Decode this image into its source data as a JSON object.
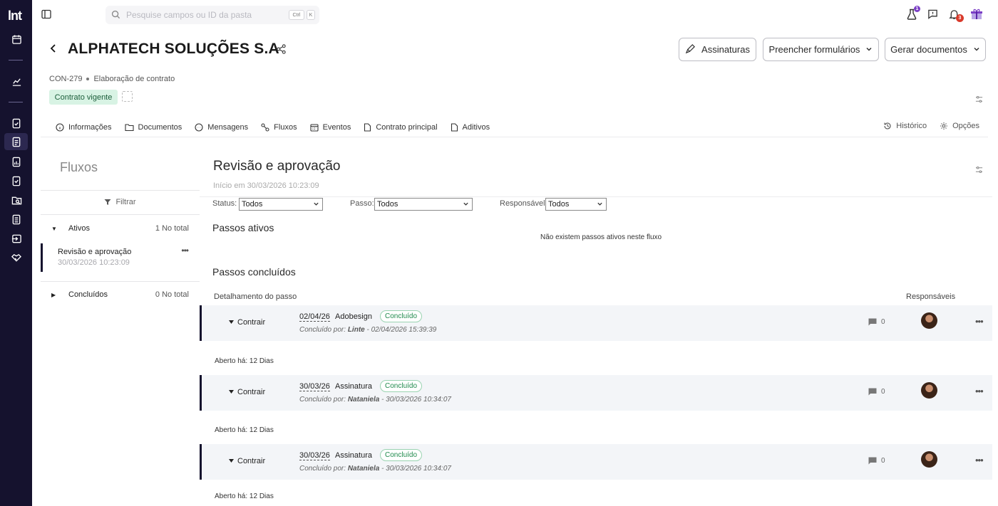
{
  "app": {
    "logo": "lnt"
  },
  "search": {
    "placeholder": "Pesquise campos ou ID da pasta",
    "shortcut_ctrl": "Ctrl",
    "shortcut_key": "K"
  },
  "topbar": {
    "flask_badge": "1",
    "notifications_badge": "3"
  },
  "header": {
    "title": "ALPHATECH SOLUÇÕES S.A",
    "code": "CON-279",
    "stage": "Elaboração de contrato",
    "status": "Contrato vigente",
    "buttons": {
      "signatures": "Assinaturas",
      "fill_forms": "Preencher formulários",
      "generate_docs": "Gerar documentos"
    }
  },
  "tabs": [
    {
      "label": "Informações",
      "icon": "info-icon"
    },
    {
      "label": "Documentos",
      "icon": "folder-icon"
    },
    {
      "label": "Mensagens",
      "icon": "chat-icon"
    },
    {
      "label": "Fluxos",
      "icon": "flow-icon"
    },
    {
      "label": "Eventos",
      "icon": "calendar-icon"
    },
    {
      "label": "Contrato principal",
      "icon": "file-icon"
    },
    {
      "label": "Aditivos",
      "icon": "file-icon"
    }
  ],
  "tabs_right": {
    "history": "Histórico",
    "options": "Opções"
  },
  "left_panel": {
    "title": "Fluxos",
    "filter": "Filtrar",
    "active_group": {
      "label": "Ativos",
      "count": "1 No total"
    },
    "active_item": {
      "name": "Revisão e aprovação",
      "date": "30/03/2026 10:23:09"
    },
    "done_group": {
      "label": "Concluídos",
      "count": "0 No total"
    }
  },
  "flow": {
    "title": "Revisão e aprovação",
    "started": "Início em 30/03/2026 10:23:09",
    "filters": {
      "status_label": "Status:",
      "status_value": "Todos",
      "step_label": "Passo:",
      "step_value": "Todos",
      "responsible_label": "Responsável:",
      "responsible_value": "Todos"
    },
    "active_steps_title": "Passos ativos",
    "no_active_msg": "Não existem passos ativos neste fluxo",
    "done_steps_title": "Passos concluídos",
    "col_detail": "Detalhamento do passo",
    "col_responsible": "Responsáveis",
    "steps": [
      {
        "toggle": "Contrair",
        "date": "02/04/26",
        "name": "Adobesign",
        "status": "Concluído",
        "by_prefix": "Concluído por:",
        "by_user": "Linte",
        "by_when": " - 02/04/2026 15:39:39",
        "comments": "0",
        "opened": "Aberto há: 12 Dias"
      },
      {
        "toggle": "Contrair",
        "date": "30/03/26",
        "name": "Assinatura",
        "status": "Concluído",
        "by_prefix": "Concluído por:",
        "by_user": "Nataniela",
        "by_when": " - 30/03/2026 10:34:07",
        "comments": "0",
        "opened": "Aberto há: 12 Dias"
      },
      {
        "toggle": "Contrair",
        "date": "30/03/26",
        "name": "Assinatura",
        "status": "Concluído",
        "by_prefix": "Concluído por:",
        "by_user": "Nataniela",
        "by_when": " - 30/03/2026 10:34:07",
        "comments": "0",
        "opened": "Aberto há: 12 Dias"
      }
    ]
  },
  "colors": {
    "rail": "#15122e",
    "accent_green": "#1f8a4c",
    "status_bg": "#d8f3e4"
  }
}
